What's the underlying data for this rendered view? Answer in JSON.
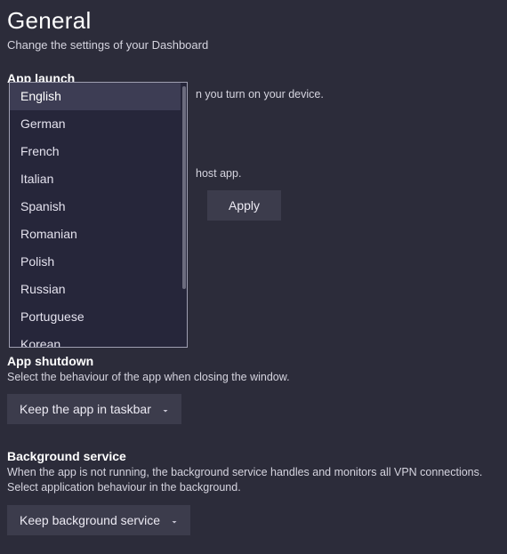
{
  "header": {
    "title": "General",
    "subtitle": "Change the settings of your Dashboard"
  },
  "launch": {
    "heading": "App launch",
    "desc_visible_fragment": "n you turn on your device."
  },
  "host": {
    "desc_visible_fragment": "host app.",
    "apply_label": "Apply"
  },
  "language": {
    "options": [
      "English",
      "German",
      "French",
      "Italian",
      "Spanish",
      "Romanian",
      "Polish",
      "Russian",
      "Portuguese",
      "Korean"
    ],
    "selected_index": 0
  },
  "shutdown": {
    "heading": "App shutdown",
    "desc": "Select the behaviour of the app when closing the window.",
    "selected_label": "Keep the app in taskbar"
  },
  "background": {
    "heading": "Background service",
    "desc": "When the app is not running, the background service handles and monitors all VPN connections. Select application behaviour in the background.",
    "selected_label": "Keep background service"
  }
}
